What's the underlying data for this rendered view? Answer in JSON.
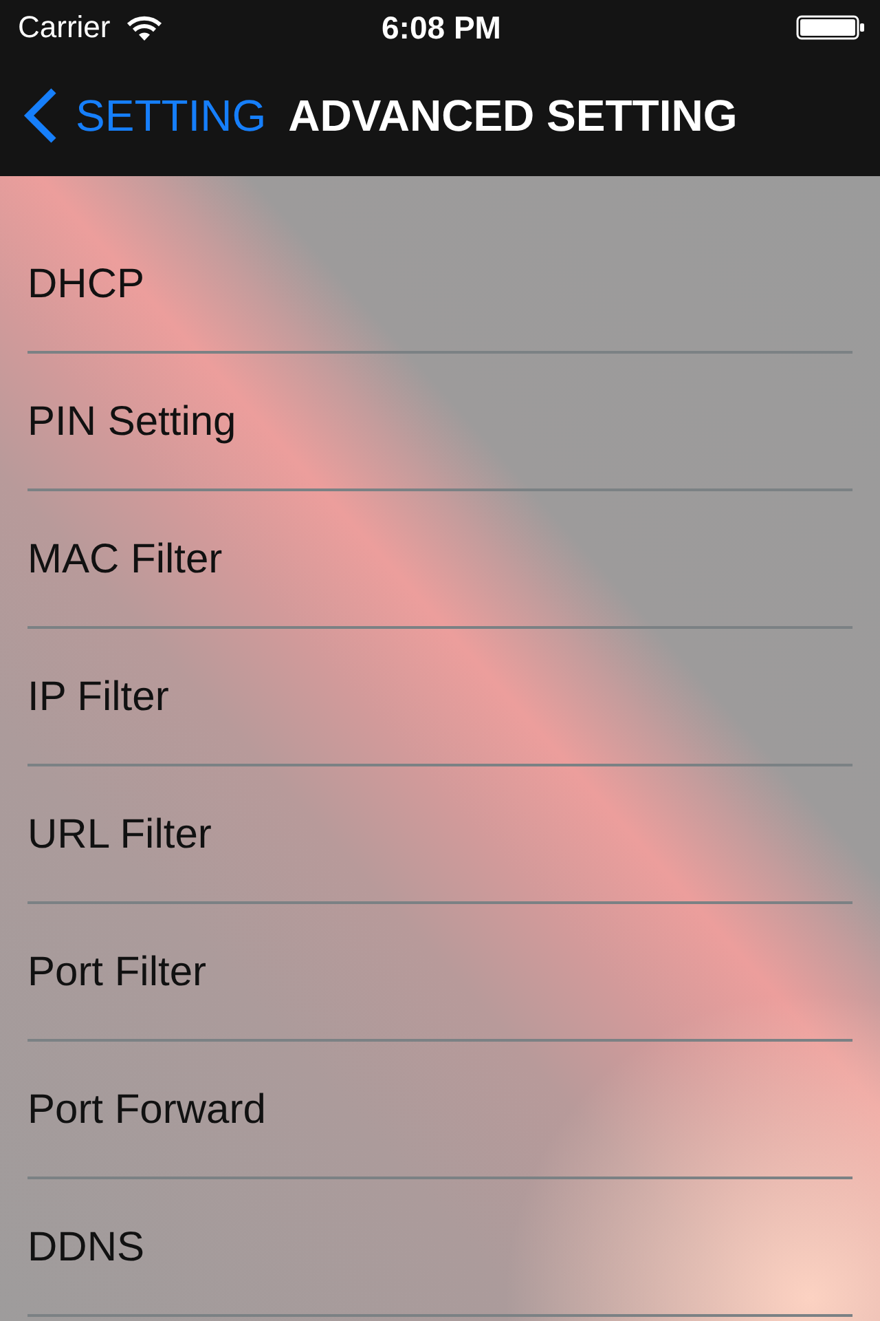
{
  "status_bar": {
    "carrier": "Carrier",
    "time": "6:08 PM"
  },
  "nav_bar": {
    "back_label": "SETTING",
    "title": "ADVANCED SETTING"
  },
  "menu_items": [
    {
      "label": "DHCP"
    },
    {
      "label": "PIN Setting"
    },
    {
      "label": "MAC Filter"
    },
    {
      "label": "IP Filter"
    },
    {
      "label": "URL Filter"
    },
    {
      "label": "Port Filter"
    },
    {
      "label": "Port Forward"
    },
    {
      "label": "DDNS"
    }
  ]
}
